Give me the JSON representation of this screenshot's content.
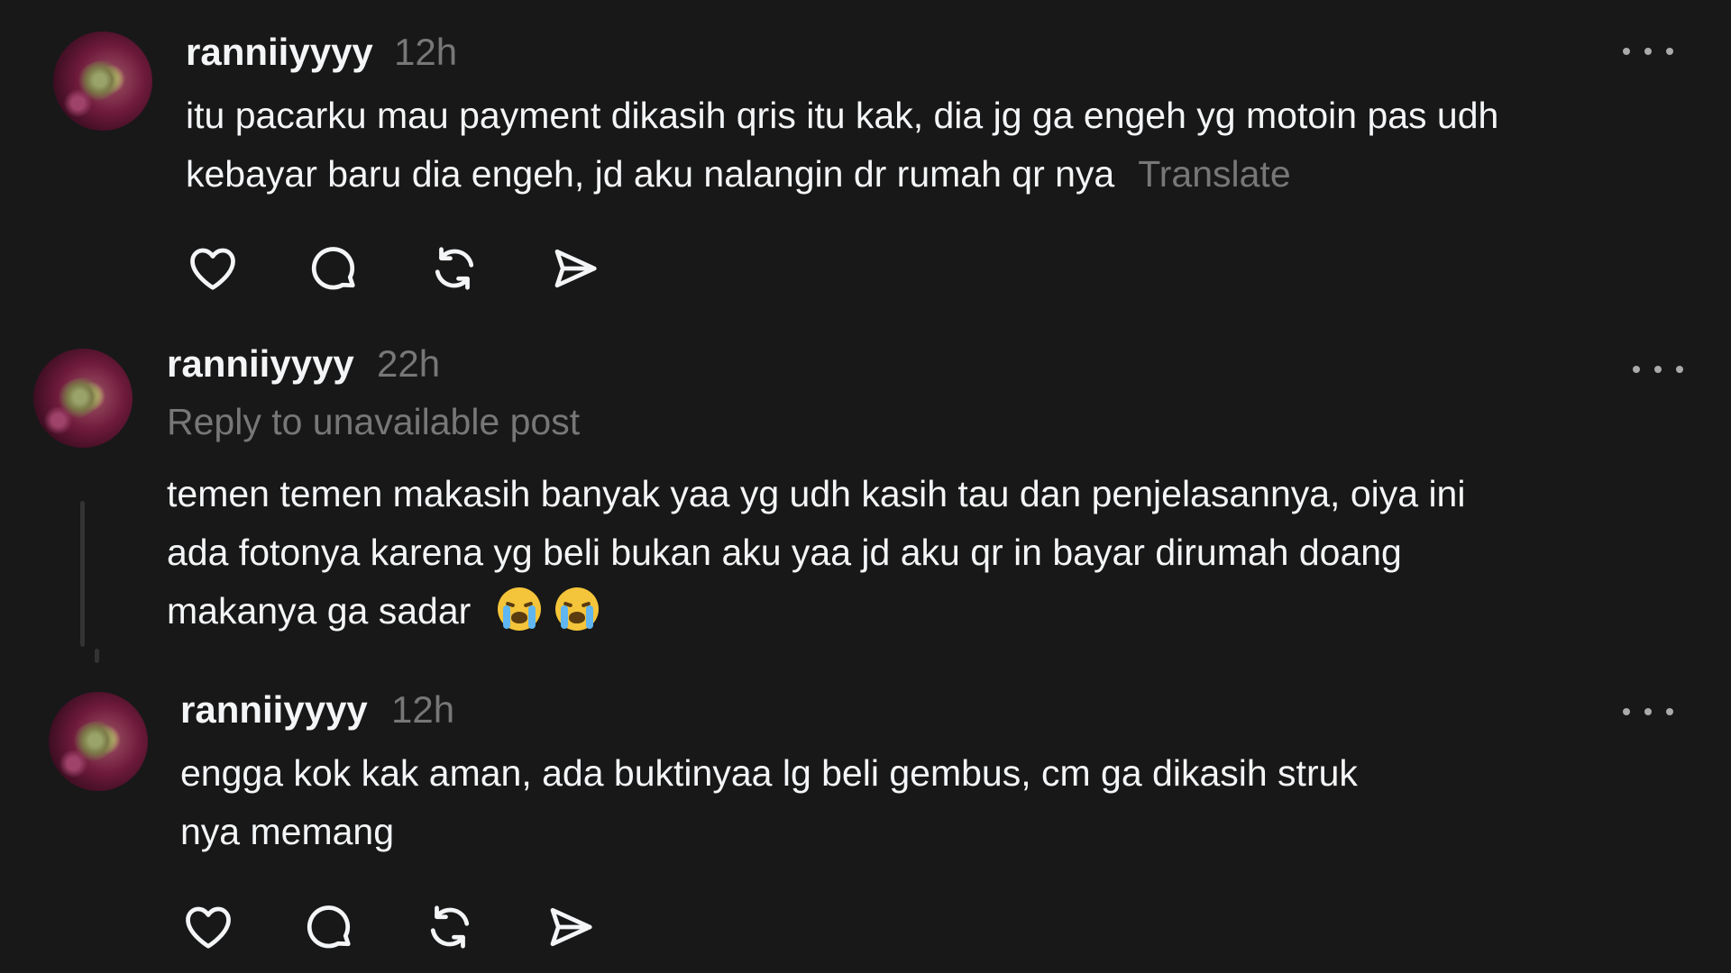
{
  "posts": [
    {
      "username": "ranniiyyyy",
      "time": "12h",
      "lines": [
        "itu pacarku mau payment dikasih qris itu kak, dia jg ga engeh yg motoin pas udh",
        "kebayar baru dia engeh, jd aku nalangin dr rumah qr nya"
      ],
      "translate": "Translate",
      "more_icon": "more-horizontal-icon",
      "actions": [
        {
          "name": "like",
          "icon": "heart-icon"
        },
        {
          "name": "reply",
          "icon": "comment-icon"
        },
        {
          "name": "repost",
          "icon": "repost-icon"
        },
        {
          "name": "share",
          "icon": "send-icon"
        }
      ]
    },
    {
      "username": "ranniiyyyy",
      "time": "22h",
      "subline": "Reply to unavailable post",
      "lines": [
        "temen temen makasih banyak yaa yg udh kasih tau dan penjelasannya, oiya ini",
        "ada fotonya karena yg beli bukan aku yaa jd aku qr in bayar dirumah doang",
        "makanya ga sadar"
      ],
      "emojis": [
        "😭",
        "😭"
      ],
      "more_icon": "more-horizontal-icon"
    },
    {
      "username": "ranniiyyyy",
      "time": "12h",
      "lines": [
        "engga kok kak aman, ada buktinyaa lg beli gembus, cm ga dikasih struk",
        "nya memang"
      ],
      "more_icon": "more-horizontal-icon",
      "actions": [
        {
          "name": "like",
          "icon": "heart-icon"
        },
        {
          "name": "reply",
          "icon": "comment-icon"
        },
        {
          "name": "repost",
          "icon": "repost-icon"
        },
        {
          "name": "share",
          "icon": "send-icon"
        }
      ]
    }
  ],
  "colors": {
    "background": "#181818",
    "primary_text": "#f3f5f7",
    "secondary_text": "#777777",
    "icon": "#f3f5f7",
    "emoji_face": "#f4c43a",
    "emoji_tear": "#5fb6f0"
  }
}
